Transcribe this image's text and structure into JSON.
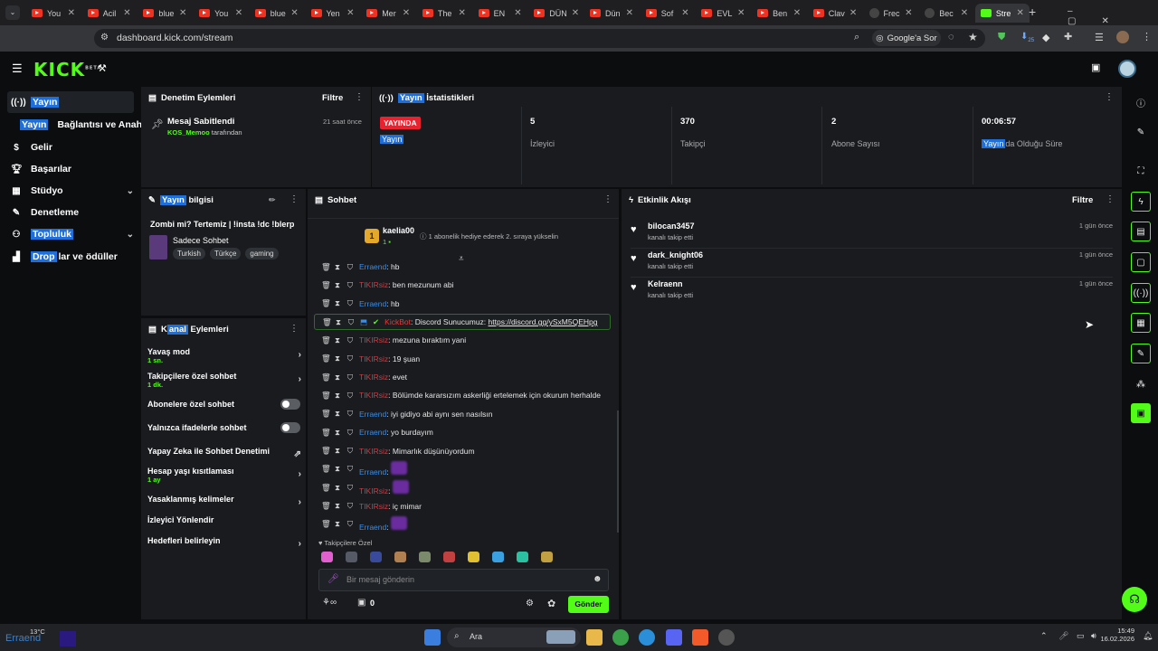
{
  "browser": {
    "tabs": [
      {
        "label": "You",
        "type": "yt"
      },
      {
        "label": "Acil",
        "type": "yt"
      },
      {
        "label": "blue",
        "type": "yt"
      },
      {
        "label": "You",
        "type": "yt"
      },
      {
        "label": "blue",
        "type": "yt"
      },
      {
        "label": "Yen",
        "type": "yt"
      },
      {
        "label": "Mer",
        "type": "yt"
      },
      {
        "label": "The",
        "type": "yt"
      },
      {
        "label": "EN",
        "type": "yt"
      },
      {
        "label": "DÜN",
        "type": "yt"
      },
      {
        "label": "Dün",
        "type": "yt"
      },
      {
        "label": "Sof",
        "type": "yt"
      },
      {
        "label": "EVL",
        "type": "yt"
      },
      {
        "label": "Ben",
        "type": "yt"
      },
      {
        "label": "Clav",
        "type": "yt"
      },
      {
        "label": "Frec",
        "type": "g"
      },
      {
        "label": "Bec",
        "type": "g"
      },
      {
        "label": "Stre",
        "type": "kick"
      }
    ],
    "url": "dashboard.kick.com/stream",
    "google_sor": "Google'a Sor",
    "ext_badge": "25"
  },
  "kick": {
    "logo": "KICK",
    "beta": "BETA"
  },
  "sidebar": {
    "items": [
      {
        "label": "Yayın",
        "icon": "broadcast-icon"
      },
      {
        "label": "Bağlantısı ve Anahtar",
        "prefix": "Yayın"
      },
      {
        "label": "Gelir",
        "icon": "money-icon"
      },
      {
        "label": "Başarılar",
        "icon": "trophy-icon"
      },
      {
        "label": "Stüdyo",
        "icon": "studio-icon"
      },
      {
        "label": "Denetleme",
        "icon": "wrench-icon"
      },
      {
        "label": "Topluluk",
        "icon": "community-icon"
      },
      {
        "label": "lar ve ödüller",
        "prefix": "Drop",
        "icon": "drops-icon"
      }
    ]
  },
  "moderation": {
    "title": "Denetim Eylemleri",
    "filter": "Filtre",
    "item_title": "Mesaj Sabitlendi",
    "item_time": "21 saat önce",
    "item_user": "KOS_Memoo",
    "item_by": "tarafından"
  },
  "stats": {
    "title_prefix": "Yayın",
    "title": "İstatistikleri",
    "live_label": "YAYINDA",
    "live_sub": "Yayın",
    "viewers": "5",
    "viewers_label": "İzleyici",
    "followers": "370",
    "followers_label": "Takipçi",
    "subs": "2",
    "subs_label": "Abone Sayısı",
    "uptime": "00:06:57",
    "uptime_prefix": "Yayın",
    "uptime_label": "da Olduğu Süre"
  },
  "stream_info": {
    "title_prefix": "Yayın",
    "title": "bilgisi",
    "stream_title": "Zombi mi? Tertemiz | !insta !dc !blerp",
    "category": "Sadece Sohbet",
    "tags": [
      "Turkish",
      "Türkçe",
      "gaming"
    ]
  },
  "channel_actions": {
    "title_prefix": "K",
    "title_hl": "anal",
    "title": " Eylemleri",
    "rows": [
      {
        "label": "Yavaş mod",
        "sub": "1 sn.",
        "kind": "arrow"
      },
      {
        "label": "Takipçilere özel sohbet",
        "sub": "1 dk.",
        "kind": "arrow"
      },
      {
        "label": "Abonelere özel sohbet",
        "sub": "",
        "kind": "toggle"
      },
      {
        "label": "Yalnızca ifadelerle sohbet",
        "sub": "",
        "kind": "toggle"
      },
      {
        "label": "Yapay Zeka ile Sohbet Denetimi",
        "sub": "",
        "kind": "external"
      },
      {
        "label": "Hesap yaşı kısıtlaması",
        "sub": "1 ay",
        "kind": "arrow"
      },
      {
        "label": "Yasaklanmış kelimeler",
        "sub": "",
        "kind": "arrow"
      },
      {
        "label": "İzleyici Yönlendir",
        "sub": "",
        "kind": "none"
      },
      {
        "label": "Hedefleri belirleyin",
        "sub": "",
        "kind": "arrow"
      }
    ]
  },
  "chat": {
    "title": "Sohbet",
    "pinned_user": "kaelia00",
    "pinned_badge": "1",
    "pinned_text": "1 abonelik hediye ederek 2. sıraya yükselin",
    "messages": [
      {
        "user": "Erraend",
        "color": "b",
        "text": "hb"
      },
      {
        "user": "TIKIRsiz",
        "color": "r",
        "text": "ben mezunum abi"
      },
      {
        "user": "Erraend",
        "color": "b",
        "text": "hb"
      },
      {
        "user": "KickBot",
        "color": "k",
        "text": "Discord Sunucumuz: ",
        "link": "https://discord.gg/ySxM5QEHpg"
      },
      {
        "user": "TIKIRsiz",
        "color": "r",
        "text": "mezuna bıraktım yani"
      },
      {
        "user": "TIKIRsiz",
        "color": "r",
        "text": "19 şuan"
      },
      {
        "user": "TIKIRsiz",
        "color": "r",
        "text": "evet"
      },
      {
        "user": "TIKIRsiz",
        "color": "r",
        "text": "Bölümde kararsızım askerliği ertelemek için okurum herhalde"
      },
      {
        "user": "Erraend",
        "color": "b",
        "text": "iyi gidiyo abi aynı sen nasılsın"
      },
      {
        "user": "Erraend",
        "color": "b",
        "text": "yo burdayım"
      },
      {
        "user": "TIKIRsiz",
        "color": "r",
        "text": "Mimarlık düşünüyordum"
      },
      {
        "user": "Erraend",
        "color": "b",
        "text": ""
      },
      {
        "user": "TIKIRsiz",
        "color": "r",
        "text": ""
      },
      {
        "user": "TIKIRsiz",
        "color": "r",
        "text": "iç mimar"
      },
      {
        "user": "Erraend",
        "color": "b",
        "text": ""
      }
    ],
    "emote_section": "Takipçilere Özel",
    "input_placeholder": "Bir mesaj gönderin",
    "points": "0",
    "send": "Gönder"
  },
  "activity": {
    "title": "Etkinlik Akışı",
    "filter": "Filtre",
    "items": [
      {
        "name": "bilocan3457",
        "sub": "kanalı takip etti",
        "time": "1 gün önce"
      },
      {
        "name": "dark_knight06",
        "sub": "kanalı takip etti",
        "time": "1 gün önce"
      },
      {
        "name": "Kelraenn",
        "sub": "kanalı takip etti",
        "time": "1 gün önce"
      }
    ]
  },
  "taskbar": {
    "weather": "13°C",
    "search": "Ara",
    "time": "15:49",
    "date": "16.02.2026",
    "overlay_name": "Erraend"
  },
  "colors": {
    "accent": "#53fc18",
    "highlight": "#1e6fd9",
    "live": "#e8232f"
  }
}
